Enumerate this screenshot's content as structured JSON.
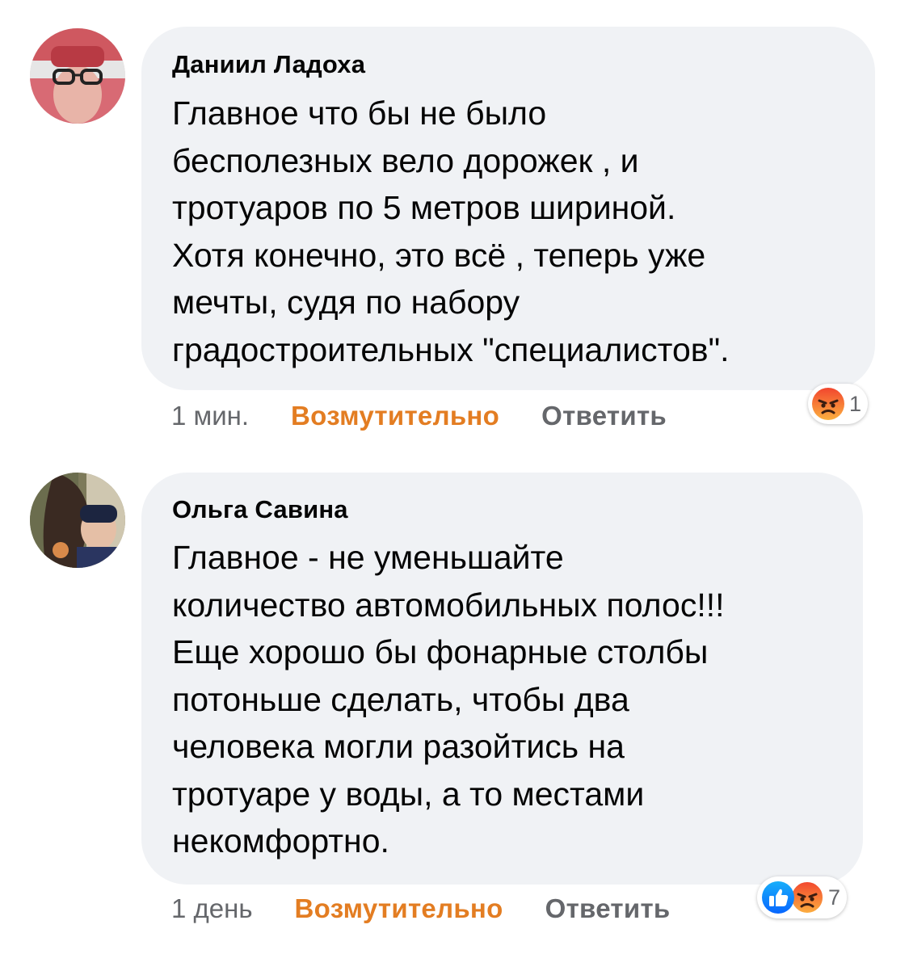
{
  "comments": [
    {
      "author": "Даниил Ладоха",
      "text": "Главное что бы не было\nбесполезных вело дорожек , и\nтротуаров по 5 метров шириной.\nХотя конечно, это всё , теперь уже\nмечты, судя по набору\nградостроительных \"специалистов\".",
      "time": "1 мин.",
      "reaction_label": "Возмутительно",
      "reply_label": "Ответить",
      "reaction_count": "1",
      "reaction_icons": [
        "angry-emoji-icon"
      ]
    },
    {
      "author": "Ольга Савина",
      "text": "Главное - не уменьшайте\nколичество автомобильных полос!!!\nЕще хорошо бы фонарные столбы\nпотоньше сделать, чтобы два\nчеловека могли разойтись на\nтротуаре у воды, а то местами\nнекомфортно.",
      "time": "1 день",
      "reaction_label": "Возмутительно",
      "reply_label": "Ответить",
      "reaction_count": "7",
      "reaction_icons": [
        "like-icon",
        "angry-emoji-icon"
      ]
    }
  ],
  "colors": {
    "bubble": "#f0f2f5",
    "reaction_accent": "#e37d22",
    "meta_text": "#65676b",
    "like_blue": "#1877f2"
  }
}
